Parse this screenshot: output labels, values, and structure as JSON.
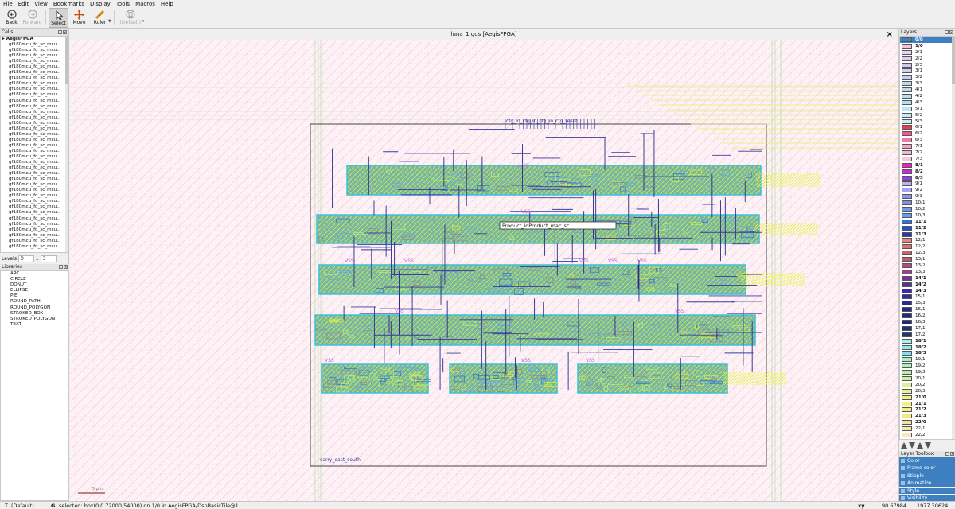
{
  "menubar": [
    "File",
    "Edit",
    "View",
    "Bookmarks",
    "Display",
    "Tools",
    "Macros",
    "Help"
  ],
  "toolbar": {
    "back": "Back",
    "forward": "Forward",
    "select": "Select",
    "move": "Move",
    "ruler": "Ruler",
    "default": "(Default)"
  },
  "cells": {
    "title": "Cells",
    "top": "AegisFPGA",
    "items": [
      "gf180mcu_fd_sc_mcu...",
      "gf180mcu_fd_sc_mcu...",
      "gf180mcu_fd_sc_mcu...",
      "gf180mcu_fd_sc_mcu...",
      "gf180mcu_fd_sc_mcu...",
      "gf180mcu_fd_sc_mcu...",
      "gf180mcu_fd_sc_mcu...",
      "gf180mcu_fd_sc_mcu...",
      "gf180mcu_fd_sc_mcu...",
      "gf180mcu_fd_sc_mcu...",
      "gf180mcu_fd_sc_mcu...",
      "gf180mcu_fd_sc_mcu...",
      "gf180mcu_fd_sc_mcu...",
      "gf180mcu_fd_sc_mcu...",
      "gf180mcu_fd_sc_mcu...",
      "gf180mcu_fd_sc_mcu...",
      "gf180mcu_fd_sc_mcu...",
      "gf180mcu_fd_sc_mcu...",
      "gf180mcu_fd_sc_mcu...",
      "gf180mcu_fd_sc_mcu...",
      "gf180mcu_fd_sc_mcu...",
      "gf180mcu_fd_sc_mcu...",
      "gf180mcu_fd_sc_mcu...",
      "gf180mcu_fd_sc_mcu...",
      "gf180mcu_fd_sc_mcu...",
      "gf180mcu_fd_sc_mcu...",
      "gf180mcu_fd_sc_mcu...",
      "gf180mcu_fd_sc_mcu...",
      "gf180mcu_fd_sc_mcu...",
      "gf180mcu_fd_sc_mcu...",
      "gf180mcu_fd_sc_mcu...",
      "gf180mcu_fd_sc_mcu...",
      "gf180mcu_fd_sc_mcu...",
      "gf180mcu_fd_sc_mcu...",
      "gf180mcu_fd_sc_mcu...",
      "gf180mcu_fd_sc_mcu...",
      "gf180mcu_fd_sc_mcu..."
    ]
  },
  "levels": {
    "label": "Levels",
    "from": "0",
    "sep": "..",
    "to": "3"
  },
  "libraries": {
    "title": "Libraries",
    "items": [
      "ARC",
      "CIRCLE",
      "DONUT",
      "ELLIPSE",
      "PIE",
      "ROUND_PATH",
      "ROUND_POLYGON",
      "STROKED_BOX",
      "STROKED_POLYGON",
      "TEXT"
    ]
  },
  "canvas": {
    "title": "luna_1.gds [AegisFPGA]",
    "close": "×",
    "label_center": "Product_iqProduct_mac_sc",
    "label_top": "cfg_in_cfg_in_cfg_in_cfg_reset",
    "label_bottom": "carry_east_south",
    "vss": "VSS",
    "scale": "5 µm"
  },
  "layers": {
    "title": "Layers",
    "items": [
      {
        "name": "0/0",
        "color": "#3d7fc1",
        "bold": true,
        "sel": true
      },
      {
        "name": "1/0",
        "color": "#f4c0d8",
        "bold": true
      },
      {
        "name": "2/1",
        "color": "#e8d4f0"
      },
      {
        "name": "2/2",
        "color": "#e0ccef"
      },
      {
        "name": "2/3",
        "color": "#d4c6ee"
      },
      {
        "name": "3/1",
        "color": "#cfd0f4"
      },
      {
        "name": "3/2",
        "color": "#c6cff3"
      },
      {
        "name": "3/3",
        "color": "#c2d6f4"
      },
      {
        "name": "4/1",
        "color": "#bcd8f2"
      },
      {
        "name": "4/2",
        "color": "#b8dcf2"
      },
      {
        "name": "4/3",
        "color": "#b2e0ef"
      },
      {
        "name": "5/1",
        "color": "#bfe4f3"
      },
      {
        "name": "5/2",
        "color": "#c8e8f4"
      },
      {
        "name": "5/3",
        "color": "#d2ecf6"
      },
      {
        "name": "6/1",
        "color": "#e8404a"
      },
      {
        "name": "6/2",
        "color": "#f05a8a"
      },
      {
        "name": "6/3",
        "color": "#ef7aa8"
      },
      {
        "name": "7/1",
        "color": "#f4a2c6"
      },
      {
        "name": "7/2",
        "color": "#f2b6d2"
      },
      {
        "name": "7/3",
        "color": "#f6c8de"
      },
      {
        "name": "8/1",
        "color": "#f020c0",
        "bold": true
      },
      {
        "name": "8/2",
        "color": "#c030d8",
        "bold": true
      },
      {
        "name": "8/3",
        "color": "#9040e0",
        "bold": true
      },
      {
        "name": "9/1",
        "color": "#c0b0f4"
      },
      {
        "name": "9/2",
        "color": "#a8a0f0"
      },
      {
        "name": "9/3",
        "color": "#9090ec"
      },
      {
        "name": "10/1",
        "color": "#8090e8"
      },
      {
        "name": "10/2",
        "color": "#7098f0"
      },
      {
        "name": "10/3",
        "color": "#60a0f0"
      },
      {
        "name": "11/1",
        "color": "#3070e0",
        "bold": true
      },
      {
        "name": "11/2",
        "color": "#2050c8",
        "bold": true
      },
      {
        "name": "11/3",
        "color": "#2040a8",
        "bold": true
      },
      {
        "name": "12/1",
        "color": "#f08080"
      },
      {
        "name": "12/2",
        "color": "#e07070"
      },
      {
        "name": "12/3",
        "color": "#d06070"
      },
      {
        "name": "13/1",
        "color": "#c05a78"
      },
      {
        "name": "13/2",
        "color": "#a85080"
      },
      {
        "name": "13/3",
        "color": "#904888"
      },
      {
        "name": "14/1",
        "color": "#703890",
        "bold": true
      },
      {
        "name": "14/2",
        "color": "#583098",
        "bold": true
      },
      {
        "name": "14/3",
        "color": "#4028a0",
        "bold": true
      },
      {
        "name": "15/1",
        "color": "#382898"
      },
      {
        "name": "15/3",
        "color": "#302890"
      },
      {
        "name": "16/1",
        "color": "#282888"
      },
      {
        "name": "16/2",
        "color": "#202880"
      },
      {
        "name": "16/3",
        "color": "#202878"
      },
      {
        "name": "17/1",
        "color": "#203070"
      },
      {
        "name": "17/2",
        "color": "#203868"
      },
      {
        "name": "18/1",
        "color": "#a0f0f8",
        "bold": true
      },
      {
        "name": "18/2",
        "color": "#90e8f4",
        "bold": true
      },
      {
        "name": "18/3",
        "color": "#80e0f0",
        "bold": true
      },
      {
        "name": "19/1",
        "color": "#a8f0c8"
      },
      {
        "name": "19/2",
        "color": "#b0f0b8"
      },
      {
        "name": "19/3",
        "color": "#b8f0a8"
      },
      {
        "name": "20/1",
        "color": "#c8f0a0"
      },
      {
        "name": "20/2",
        "color": "#d8f098"
      },
      {
        "name": "20/3",
        "color": "#e8f090"
      },
      {
        "name": "21/0",
        "color": "#f0f088",
        "bold": true
      },
      {
        "name": "21/1",
        "color": "#f4f080",
        "bold": true
      },
      {
        "name": "21/2",
        "color": "#f8ec80",
        "bold": true
      },
      {
        "name": "21/3",
        "color": "#f8e880",
        "bold": true
      },
      {
        "name": "22/0",
        "color": "#f8e0a0",
        "bold": true
      },
      {
        "name": "22/1",
        "color": "#f8e4b0"
      },
      {
        "name": "22/2",
        "color": "#f8e8c0"
      },
      {
        "name": "22/3",
        "color": "#f8ecd0"
      }
    ]
  },
  "toolbox": {
    "title": "Layer Toolbox",
    "items": [
      "Color",
      "Frame color",
      "Stipple",
      "Animation",
      "Style",
      "Visibility"
    ]
  },
  "status": {
    "mode": "T",
    "mode_val": "(Default)",
    "g": "G",
    "selected": "selected: box(0,0 72000,54000) on 1/0 in AegisFPGA/DspBasicTile@1",
    "xy": "xy",
    "x": "90.67984",
    "y": "1977.30624"
  }
}
